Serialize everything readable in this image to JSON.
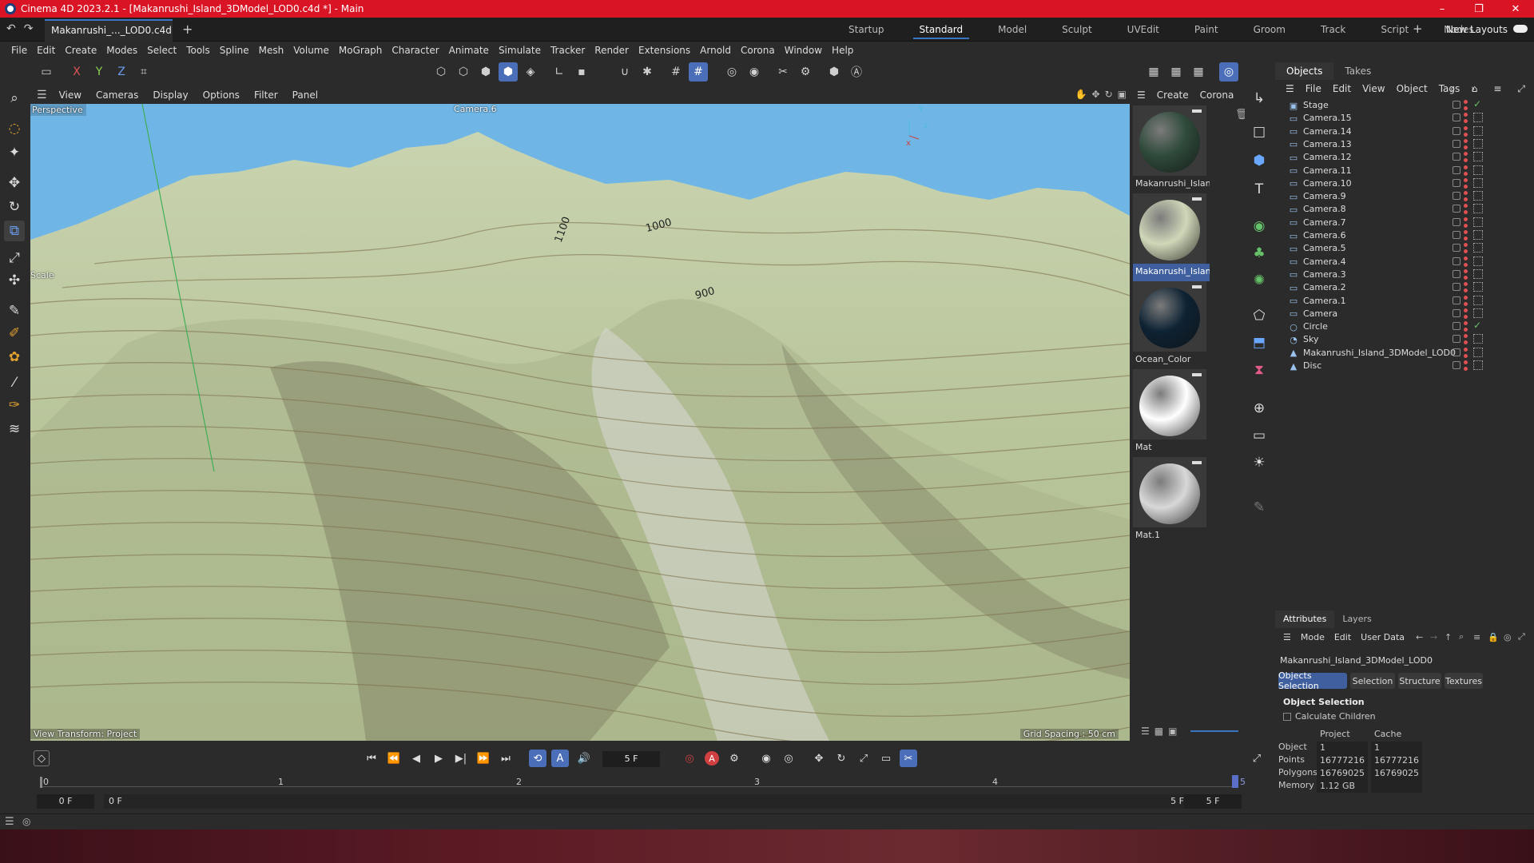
{
  "window": {
    "title": "Cinema 4D 2023.2.1 - [Makanrushi_Island_3DModel_LOD0.c4d *] - Main",
    "minimize": "–",
    "restore": "❐",
    "close": "✕"
  },
  "tabbar": {
    "doc_tab": "Makanrushi_..._LOD0.c4d *",
    "layouts": [
      "Startup",
      "Standard",
      "Model",
      "Sculpt",
      "UVEdit",
      "Paint",
      "Groom",
      "Track",
      "Script",
      "Nodes"
    ],
    "active_layout": "Standard",
    "new_layouts": "New Layouts"
  },
  "menubar": [
    "File",
    "Edit",
    "Create",
    "Modes",
    "Select",
    "Tools",
    "Spline",
    "Mesh",
    "Volume",
    "MoGraph",
    "Character",
    "Animate",
    "Simulate",
    "Tracker",
    "Render",
    "Extensions",
    "Arnold",
    "Corona",
    "Window",
    "Help"
  ],
  "toolbar": {
    "axis_x": "X",
    "axis_y": "Y",
    "axis_z": "Z"
  },
  "viewport": {
    "menu": [
      "View",
      "Cameras",
      "Display",
      "Options",
      "Filter",
      "Panel"
    ],
    "label": "Perspective",
    "camera": "Camera.6",
    "scale": "Scale",
    "transform": "View Transform: Project",
    "grid": "Grid Spacing : 50 cm",
    "contour_labels": [
      "1100",
      "1000",
      "900"
    ],
    "axis_labels": {
      "y": "y",
      "z": "z",
      "x": "x"
    }
  },
  "materials": {
    "menu": [
      "Create",
      "Corona"
    ],
    "items": [
      {
        "name": "Makanrushi_Island",
        "color": "#2e4a3a",
        "selected": false
      },
      {
        "name": "Makanrushi_Island",
        "color": "#cfd7b8",
        "selected": true
      },
      {
        "name": "Ocean_Color",
        "color": "#0d2233",
        "selected": false
      },
      {
        "name": "Mat",
        "color": "#ffffff",
        "selected": false
      },
      {
        "name": "Mat.1",
        "color": "#d8d8d8",
        "selected": false
      }
    ]
  },
  "objects_panel": {
    "tabs": [
      "Objects",
      "Takes"
    ],
    "menu": [
      "File",
      "Edit",
      "View",
      "Object",
      "Tags"
    ],
    "rows": [
      {
        "name": "Stage",
        "icon": "stage-icon",
        "check": true
      },
      {
        "name": "Camera.15",
        "icon": "camera-icon"
      },
      {
        "name": "Camera.14",
        "icon": "camera-icon"
      },
      {
        "name": "Camera.13",
        "icon": "camera-icon"
      },
      {
        "name": "Camera.12",
        "icon": "camera-icon"
      },
      {
        "name": "Camera.11",
        "icon": "camera-icon"
      },
      {
        "name": "Camera.10",
        "icon": "camera-icon"
      },
      {
        "name": "Camera.9",
        "icon": "camera-icon"
      },
      {
        "name": "Camera.8",
        "icon": "camera-icon"
      },
      {
        "name": "Camera.7",
        "icon": "camera-icon"
      },
      {
        "name": "Camera.6",
        "icon": "camera-icon"
      },
      {
        "name": "Camera.5",
        "icon": "camera-icon"
      },
      {
        "name": "Camera.4",
        "icon": "camera-icon"
      },
      {
        "name": "Camera.3",
        "icon": "camera-icon"
      },
      {
        "name": "Camera.2",
        "icon": "camera-icon"
      },
      {
        "name": "Camera.1",
        "icon": "camera-icon"
      },
      {
        "name": "Camera",
        "icon": "camera-icon"
      },
      {
        "name": "Circle",
        "icon": "circle-icon",
        "check": true
      },
      {
        "name": "Sky",
        "icon": "sky-icon"
      },
      {
        "name": "Makanrushi_Island_3DModel_LOD0",
        "icon": "polygon-icon"
      },
      {
        "name": "Disc",
        "icon": "polygon-icon"
      }
    ]
  },
  "attributes": {
    "tabs": [
      "Attributes",
      "Layers"
    ],
    "menu": [
      "Mode",
      "Edit",
      "User Data"
    ],
    "object_name": "Makanrushi_Island_3DModel_LOD0",
    "subtabs": [
      "Objects Selection",
      "Selection",
      "Structure",
      "Textures"
    ],
    "section": "Object Selection",
    "calculate_children": "Calculate Children",
    "columns": [
      "Project",
      "Cache"
    ],
    "stats": [
      {
        "label": "Object",
        "project": "1",
        "cache": "1"
      },
      {
        "label": "Points",
        "project": "16777216",
        "cache": "16777216"
      },
      {
        "label": "Polygons",
        "project": "16769025",
        "cache": "16769025"
      },
      {
        "label": "Memory",
        "project": "1.12 GB",
        "cache": ""
      }
    ]
  },
  "timeline": {
    "current_frame": "5 F",
    "ticks": [
      "0",
      "1",
      "2",
      "3",
      "4",
      "5"
    ],
    "start": "0 F",
    "min": "0 F",
    "max": "5 F",
    "end": "5 F",
    "record": "A"
  },
  "colors": {
    "titlebar": "#d91424",
    "accent": "#4a6fb8",
    "panel": "#2b2b2b"
  }
}
